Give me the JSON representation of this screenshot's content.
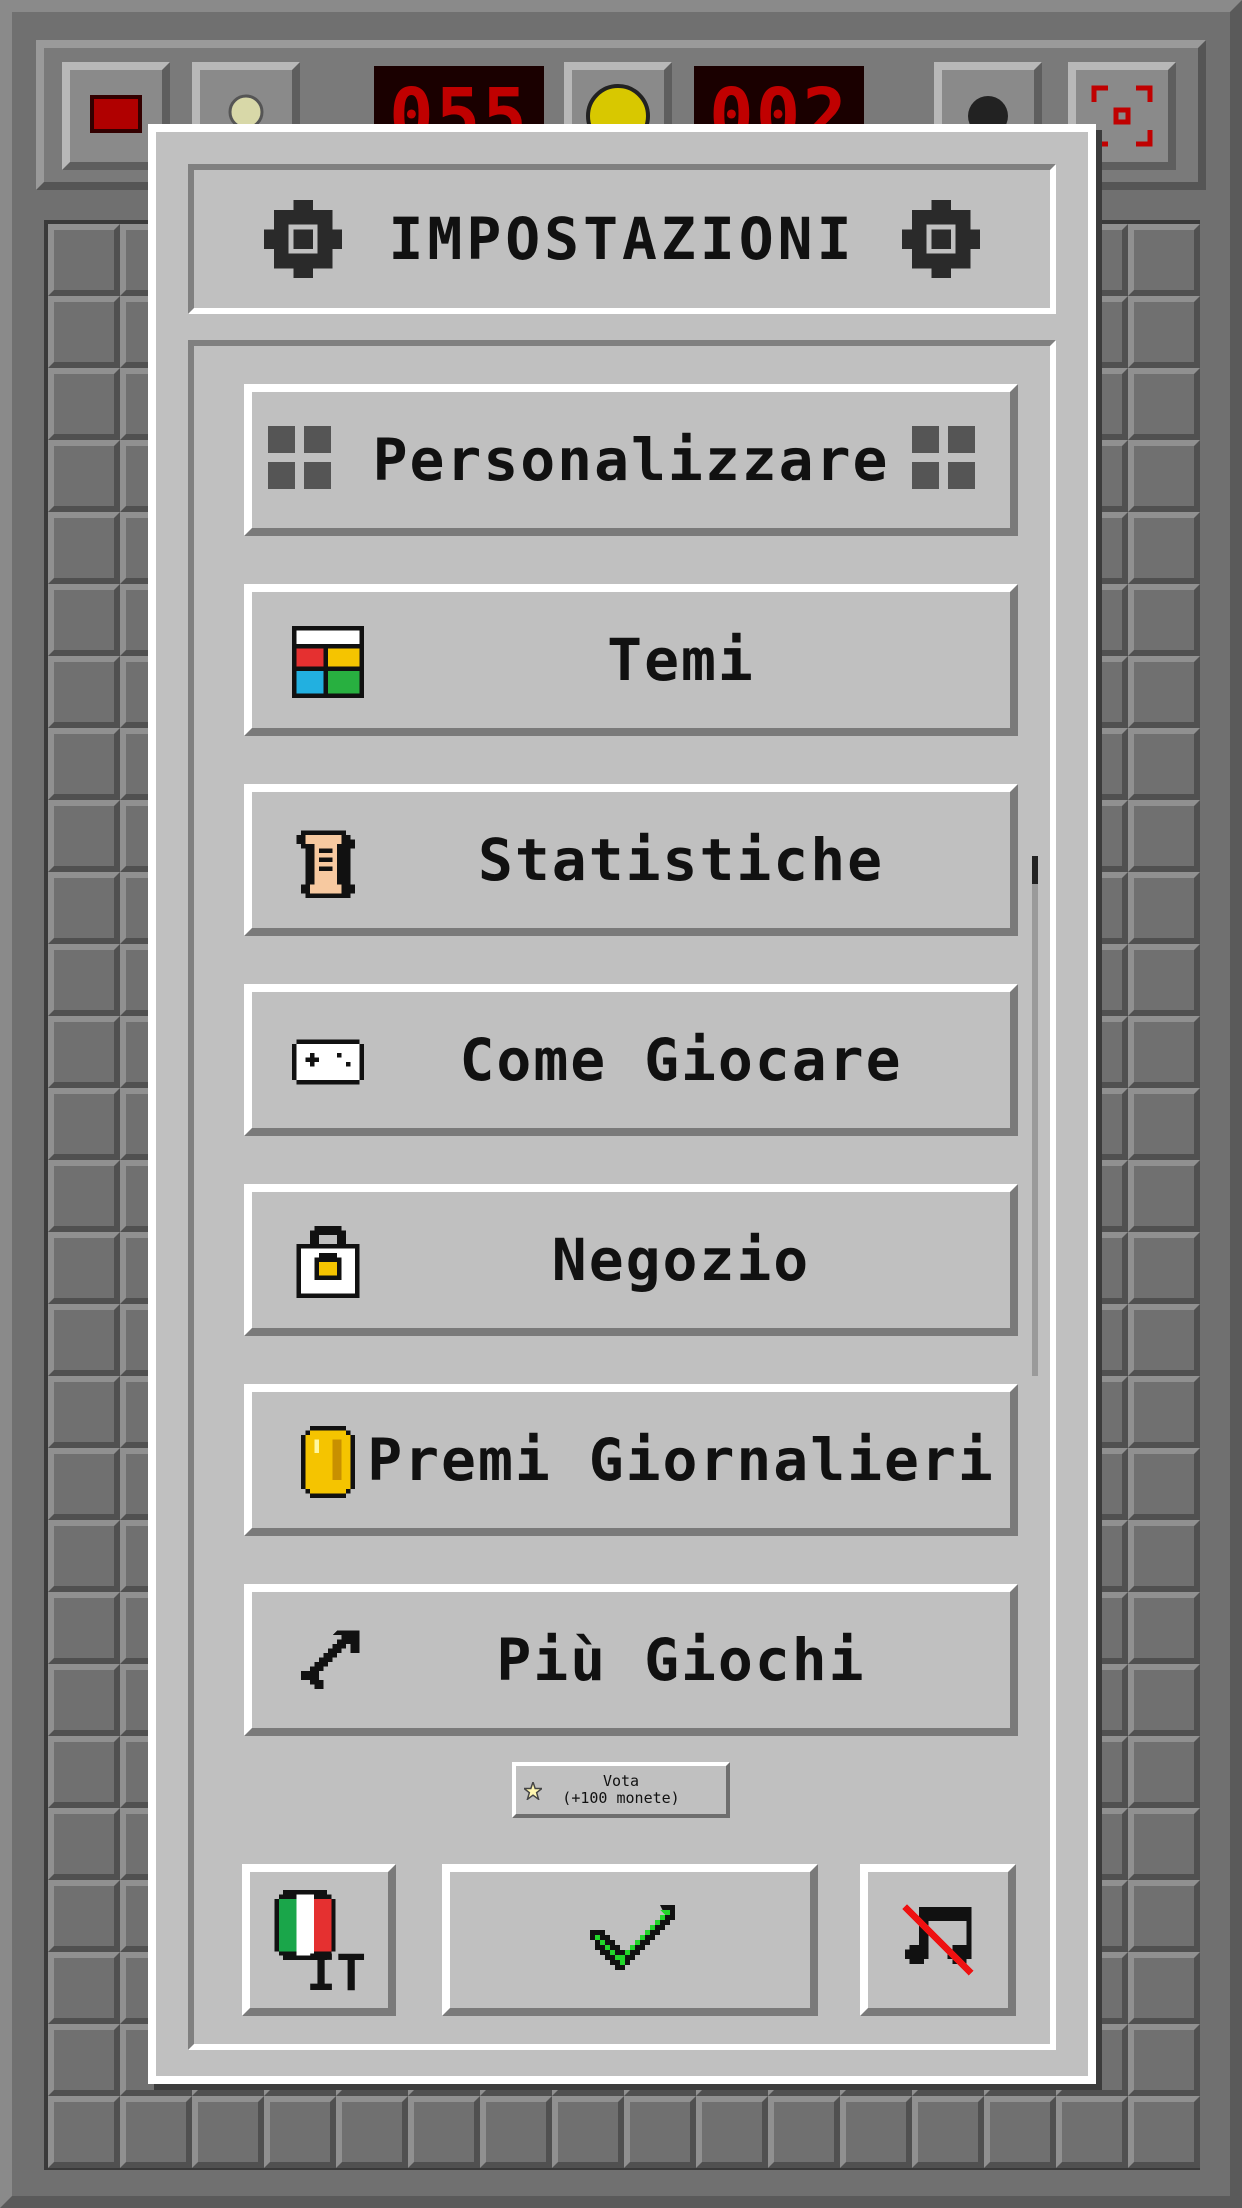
{
  "header": {
    "mine_counter": "055",
    "timer": "002",
    "icons": [
      "flag-icon",
      "hint-bulb-icon",
      "smiley-face-icon",
      "gear-icon",
      "fullscreen-icon"
    ]
  },
  "dialog": {
    "title": "IMPOSTAZIONI",
    "menu": {
      "personalize": "Personalizzare",
      "themes": "Temi",
      "stats": "Statistiche",
      "how_to_play": "Come Giocare",
      "shop": "Negozio",
      "daily_rewards": "Premi Giornalieri",
      "more_games": "Più Giochi"
    },
    "rate": {
      "line1": "Vota",
      "line2": "(+100 monete)"
    },
    "language_code": "IT"
  },
  "colors": {
    "dialog_bg": "#c0c0c0",
    "lcd_red": "#c00000",
    "confirm_green": "#22cc22",
    "mute_red": "#ee1111"
  }
}
